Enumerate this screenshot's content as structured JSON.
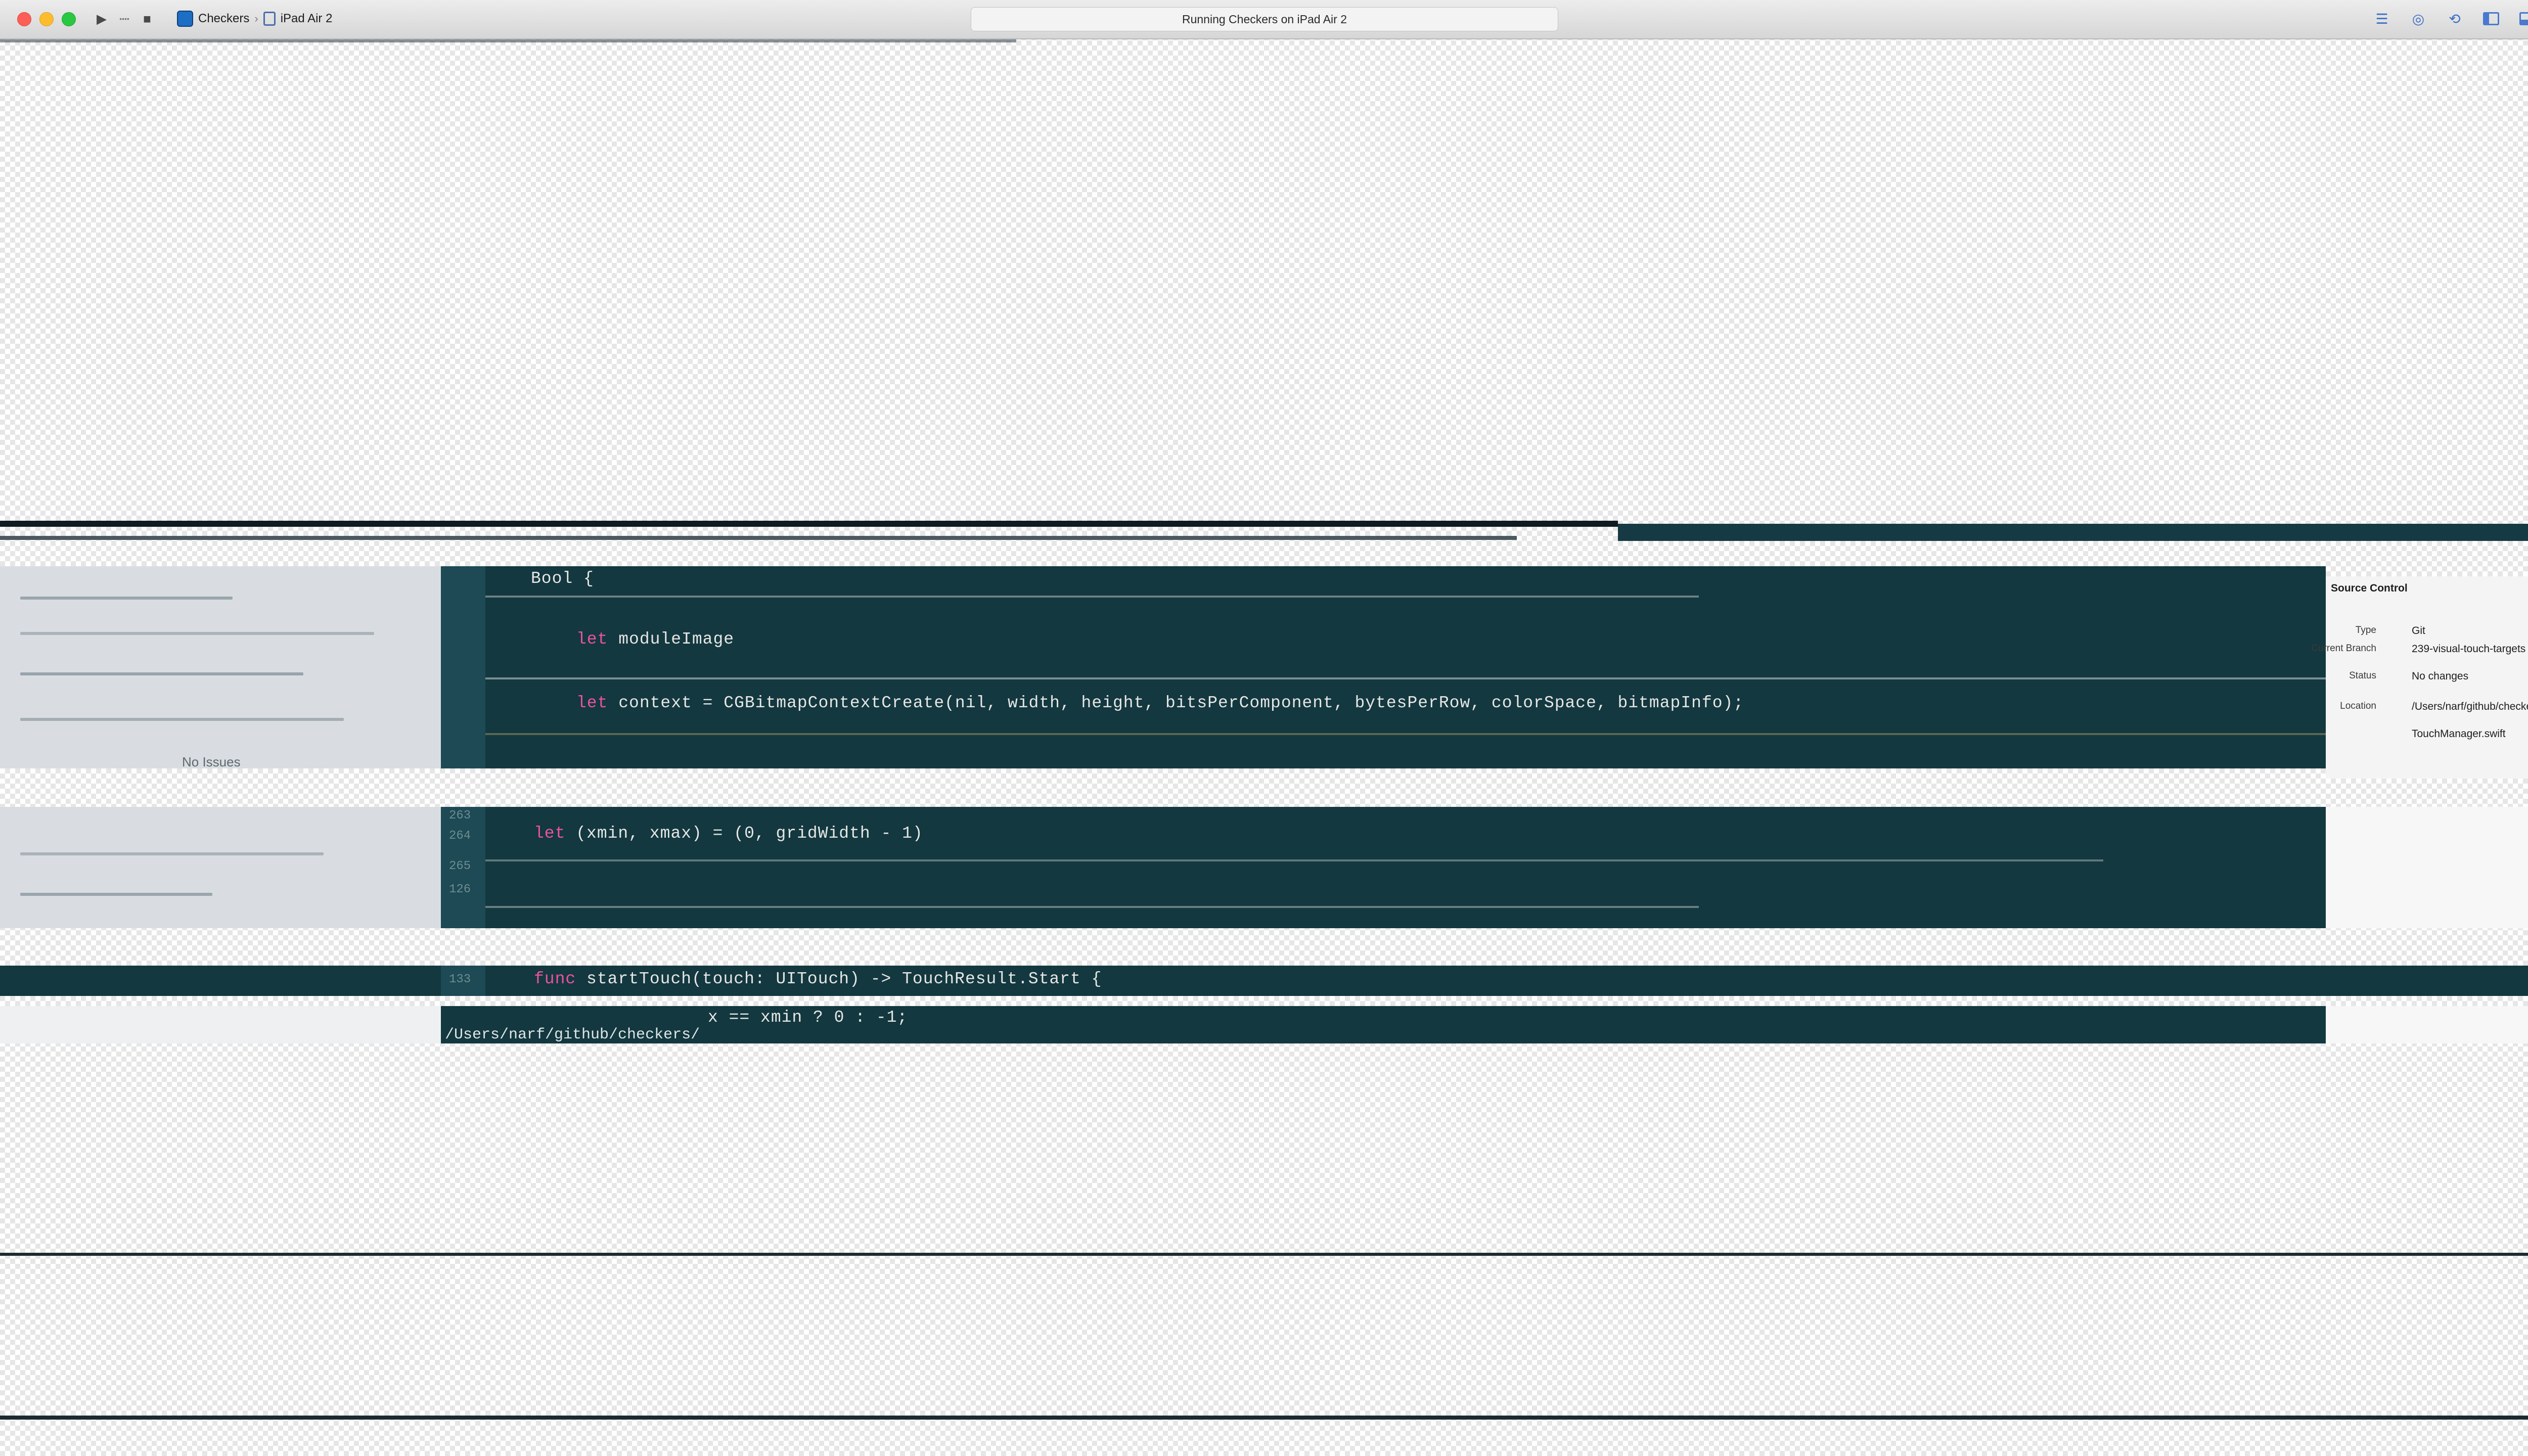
{
  "window": {
    "activity_text": "Running Checkers on iPad Air 2",
    "scheme_app": "Checkers",
    "scheme_separator": "›",
    "scheme_device": "iPad Air 2",
    "run_icon": "play-icon",
    "stop_icon": "stop-icon",
    "toolbar_icons": [
      "editor-standard-icon",
      "editor-assistant-icon",
      "editor-version-icon",
      "toggle-navigator-icon",
      "toggle-debug-area-icon",
      "toggle-utilities-icon"
    ]
  },
  "editor": {
    "lines": [
      {
        "no": "",
        "text_kw": "",
        "text": "Bool {"
      },
      {
        "no": "",
        "text_kw": "let ",
        "text": "moduleImage"
      },
      {
        "no": "",
        "text_kw": "let ",
        "text": "context = CGBitmapContextCreate(nil, width, height, bitsPerComponent, bytesPerRow, colorSpace, bitmapInfo);"
      },
      {
        "no": "263",
        "text_kw": "",
        "text": ""
      },
      {
        "no": "264",
        "text_kw": "let ",
        "text": "(xmin, xmax) = (0, gridWidth - 1)"
      },
      {
        "no": "265",
        "text_kw": "",
        "text": ""
      },
      {
        "no": "126",
        "text_kw": "",
        "text": ""
      },
      {
        "no": "133",
        "text_kw": "func ",
        "text": "startTouch(touch: UITouch) -> TouchResult.Start {"
      },
      {
        "no": "",
        "text_kw": "",
        "text": "x == xmin ? 0 : -1;"
      }
    ],
    "path_text": "/Users/narf/github/checkers/",
    "no_issues": "No Issues"
  },
  "inspector": {
    "section_title": "Source Control",
    "rows": [
      {
        "key": "Type",
        "value": "Git"
      },
      {
        "key": "Current Branch",
        "value": "239-visual-touch-targets"
      },
      {
        "key": "Status",
        "value": "No changes"
      },
      {
        "key": "Location",
        "value": "/Users/narf/github/checkers/"
      },
      {
        "key": "",
        "value": "TouchManager.swift"
      }
    ]
  },
  "colors": {
    "editor_bg": "#13383f",
    "keyword": "#e9539f",
    "number": "#f2d25c",
    "accent": "#4a79cf"
  }
}
